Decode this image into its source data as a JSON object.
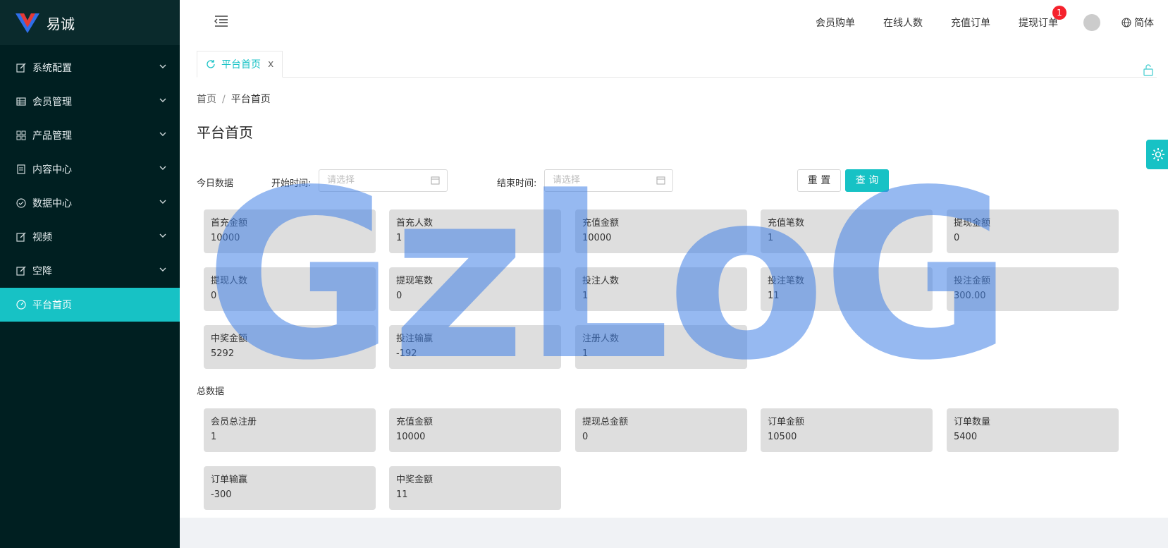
{
  "sidebar": {
    "brand": "易诚",
    "items": [
      {
        "label": "系统配置",
        "icon": "edit-icon"
      },
      {
        "label": "会员管理",
        "icon": "table-icon"
      },
      {
        "label": "产品管理",
        "icon": "grid-icon"
      },
      {
        "label": "内容中心",
        "icon": "document-icon"
      },
      {
        "label": "数据中心",
        "icon": "check-circle-icon"
      },
      {
        "label": "视频",
        "icon": "edit-icon"
      },
      {
        "label": "空降",
        "icon": "edit-icon"
      },
      {
        "label": "平台首页",
        "icon": "dashboard-icon",
        "active": true
      }
    ]
  },
  "header": {
    "nav": [
      "会员购单",
      "在线人数",
      "充值订单",
      "提现订单"
    ],
    "withdraw_badge": "1",
    "lang": "简体"
  },
  "tabs": [
    {
      "label": "平台首页",
      "close": "x"
    }
  ],
  "breadcrumb": {
    "home": "首页",
    "sep": "/",
    "current": "平台首页"
  },
  "page_title": "平台首页",
  "filter": {
    "today_label": "今日数据",
    "start_label": "开始时间:",
    "start_placeholder": "请选择",
    "end_label": "结束时间:",
    "end_placeholder": "请选择",
    "reset": "重 置",
    "query": "查 询"
  },
  "today": [
    {
      "title": "首充金额",
      "value": "10000"
    },
    {
      "title": "首充人数",
      "value": "1"
    },
    {
      "title": "充值金额",
      "value": "10000"
    },
    {
      "title": "充值笔数",
      "value": "1"
    },
    {
      "title": "提现金额",
      "value": "0"
    },
    {
      "title": "提现人数",
      "value": "0"
    },
    {
      "title": "提现笔数",
      "value": "0"
    },
    {
      "title": "投注人数",
      "value": "1"
    },
    {
      "title": "投注笔数",
      "value": "11"
    },
    {
      "title": "投注金额",
      "value": "300.00"
    },
    {
      "title": "中奖金额",
      "value": "5292"
    },
    {
      "title": "投注输赢",
      "value": "-192"
    },
    {
      "title": "注册人数",
      "value": "1"
    }
  ],
  "total_label": "总数据",
  "total": [
    {
      "title": "会员总注册",
      "value": "1"
    },
    {
      "title": "充值金额",
      "value": "10000"
    },
    {
      "title": "提现总金额",
      "value": "0"
    },
    {
      "title": "订单金额",
      "value": "10500"
    },
    {
      "title": "订单数量",
      "value": "5400"
    },
    {
      "title": "订单输赢",
      "value": "-300"
    },
    {
      "title": "中奖金额",
      "value": "11"
    }
  ],
  "watermark": "GzLoG",
  "colors": {
    "accent": "#17c2c5",
    "sidebar": "#001f21",
    "card": "#dedede",
    "badge": "#f5222d"
  }
}
